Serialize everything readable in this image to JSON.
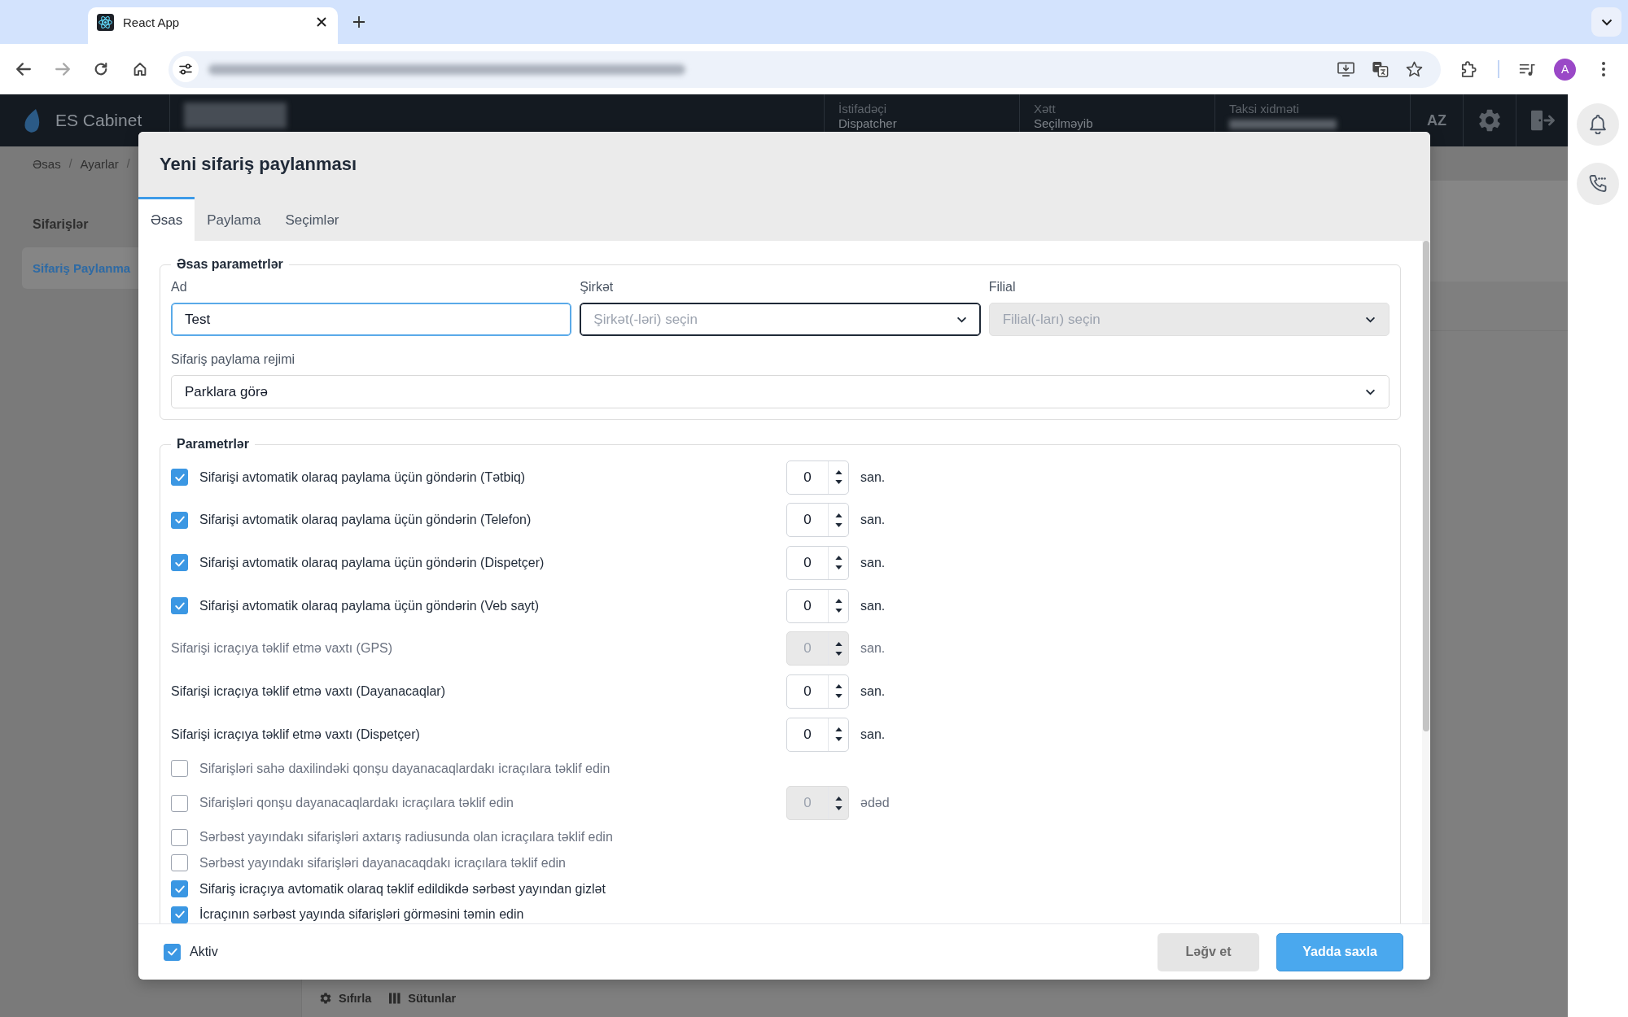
{
  "browser": {
    "tab_title": "React App",
    "profile_initial": "A"
  },
  "app_header": {
    "brand": "ES Cabinet",
    "fields": [
      {
        "kind": "text",
        "label": "İstifadəçi",
        "value": "Dispatcher"
      },
      {
        "kind": "text",
        "label": "Xətt",
        "value": "Seçilməyib"
      },
      {
        "kind": "blurred",
        "label": "Taksi xidməti"
      }
    ],
    "language": "AZ"
  },
  "page": {
    "breadcrumb": [
      {
        "kind": "link",
        "label": "Əsas"
      },
      {
        "kind": "separator",
        "label": "/"
      },
      {
        "kind": "link",
        "label": "Ayarlar"
      },
      {
        "kind": "separator",
        "label": "/"
      }
    ],
    "sidebar": [
      {
        "label": "Sifarişlər",
        "selected": false
      },
      {
        "label": "Sifariş Paylanma",
        "selected": true
      }
    ],
    "toolbar": [
      {
        "kind": "reset",
        "label": "Sıfırla"
      },
      {
        "kind": "columns",
        "label": "Sütunlar"
      }
    ]
  },
  "modal": {
    "title": "Yeni sifariş paylanması",
    "tabs": [
      {
        "label": "Əsas",
        "selected": true
      },
      {
        "label": "Paylama",
        "selected": false
      },
      {
        "label": "Seçimlər",
        "selected": false
      }
    ],
    "basic": {
      "legend": "Əsas parametrlər",
      "fields": [
        {
          "kind": "text",
          "label": "Ad",
          "value": "Test",
          "focused": true,
          "hovered": false,
          "disabled": false
        },
        {
          "kind": "select",
          "label": "Şirkət",
          "placeholder": "Şirkət(-ləri) seçin",
          "focused": false,
          "hovered": true,
          "disabled": false
        },
        {
          "kind": "select",
          "label": "Filial",
          "placeholder": "Filial(-ları) seçin",
          "focused": false,
          "hovered": false,
          "disabled": true
        }
      ],
      "mode": {
        "kind": "select",
        "label": "Sifariş paylama rejimi",
        "value": "Parklara görə",
        "focused": false,
        "hovered": false,
        "disabled": false
      }
    },
    "parameters": {
      "legend": "Parametrlər",
      "rows": [
        {
          "kind": "check_number",
          "label": "Sifarişi avtomatik olaraq paylama üçün göndərin (Tətbiq)",
          "checked": true,
          "value": "0",
          "unit": "san.",
          "disabled": false
        },
        {
          "kind": "check_number",
          "label": "Sifarişi avtomatik olaraq paylama üçün göndərin (Telefon)",
          "checked": true,
          "value": "0",
          "unit": "san.",
          "disabled": false
        },
        {
          "kind": "check_number",
          "label": "Sifarişi avtomatik olaraq paylama üçün göndərin (Dispetçer)",
          "checked": true,
          "value": "0",
          "unit": "san.",
          "disabled": false
        },
        {
          "kind": "check_number",
          "label": "Sifarişi avtomatik olaraq paylama üçün göndərin (Veb sayt)",
          "checked": true,
          "value": "0",
          "unit": "san.",
          "disabled": false
        },
        {
          "kind": "number",
          "label": "Sifarişi icraçıya təklif etmə vaxtı (GPS)",
          "value": "0",
          "unit": "san.",
          "disabled": true
        },
        {
          "kind": "number",
          "label": "Sifarişi icraçıya təklif etmə vaxtı (Dayanacaqlar)",
          "value": "0",
          "unit": "san.",
          "disabled": false
        },
        {
          "kind": "number",
          "label": "Sifarişi icraçıya təklif etmə vaxtı (Dispetçer)",
          "value": "0",
          "unit": "san.",
          "disabled": false
        },
        {
          "kind": "check",
          "label": "Sifarişləri sahə daxilindəki qonşu dayanacaqlardakı icraçılara təklif edin",
          "checked": false
        },
        {
          "kind": "check_number",
          "label": "Sifarişləri qonşu dayanacaqlardakı icraçılara təklif edin",
          "checked": false,
          "value": "0",
          "unit": "ədəd",
          "disabled": true
        },
        {
          "kind": "check",
          "label": "Sərbəst yayındakı sifarişləri axtarış radiusunda olan icraçılara təklif edin",
          "checked": false
        },
        {
          "kind": "check",
          "label": "Sərbəst yayındakı sifarişləri dayanacaqdakı icraçılara təklif edin",
          "checked": false
        },
        {
          "kind": "check",
          "label": "Sifariş icraçıya avtomatik olaraq təklif edildikdə sərbəst yayından gizlət",
          "checked": true
        },
        {
          "kind": "check",
          "label": "İcraçının sərbəst yayında sifarişləri görməsini təmin edin",
          "checked": true
        }
      ]
    },
    "footer": {
      "active": {
        "label": "Aktiv",
        "checked": true
      },
      "buttons": [
        {
          "kind": "secondary",
          "label": "Ləğv et"
        },
        {
          "kind": "primary",
          "label": "Yadda saxla"
        }
      ]
    }
  }
}
